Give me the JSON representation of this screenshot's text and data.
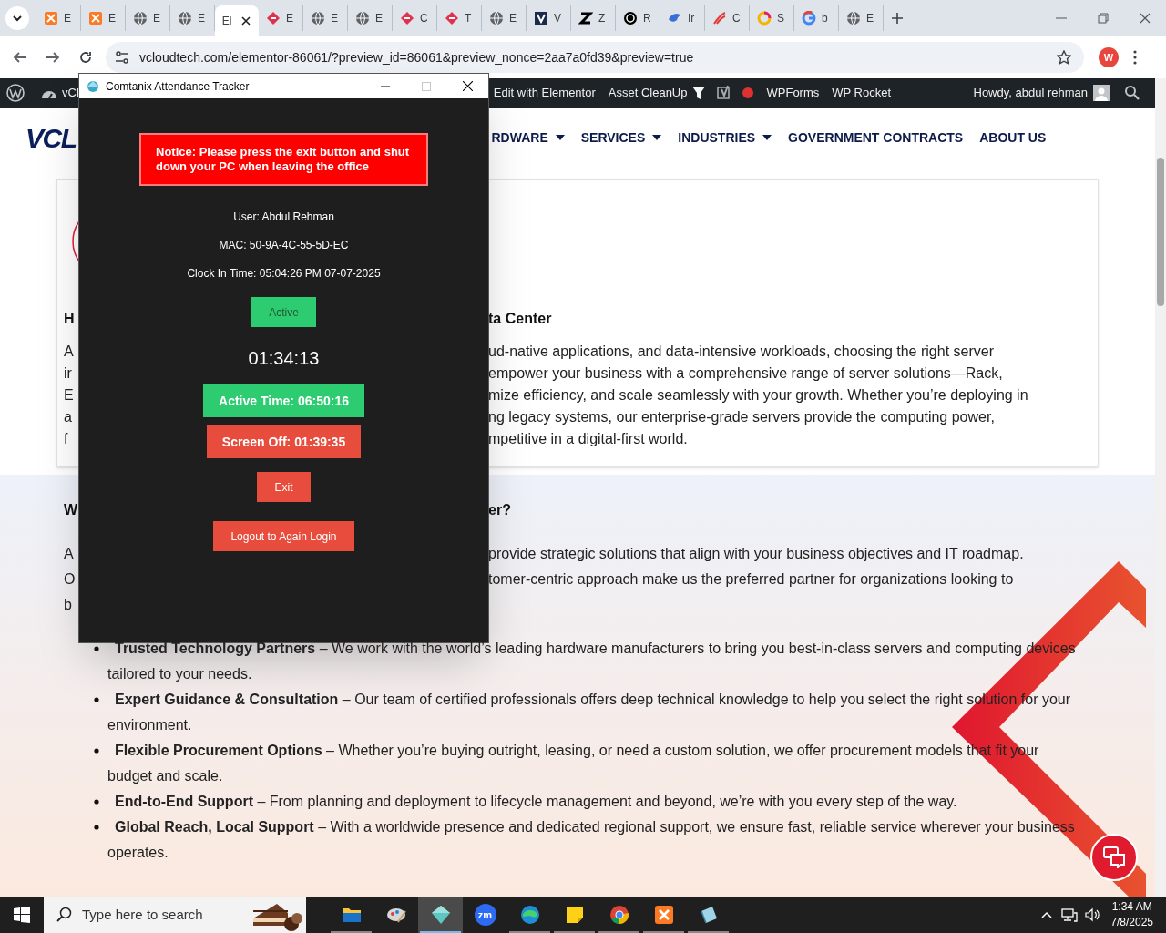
{
  "browser": {
    "tabs": [
      {
        "label": "E",
        "kind": "xampp",
        "selected": false
      },
      {
        "label": "E",
        "kind": "xampp",
        "selected": false
      },
      {
        "label": "E",
        "kind": "globe",
        "selected": false
      },
      {
        "label": "E",
        "kind": "globe",
        "selected": false
      },
      {
        "label": "El",
        "kind": "none",
        "selected": true
      },
      {
        "label": "E",
        "kind": "elementor",
        "selected": false
      },
      {
        "label": "E",
        "kind": "globe",
        "selected": false
      },
      {
        "label": "E",
        "kind": "globe",
        "selected": false
      },
      {
        "label": "C",
        "kind": "elementor",
        "selected": false
      },
      {
        "label": "T",
        "kind": "elementor",
        "selected": false
      },
      {
        "label": "E",
        "kind": "globe",
        "selected": false
      },
      {
        "label": "V",
        "kind": "vlogo",
        "selected": false
      },
      {
        "label": "Z",
        "kind": "zlogo",
        "selected": false
      },
      {
        "label": "R",
        "kind": "knot",
        "selected": false
      },
      {
        "label": "Ir",
        "kind": "bird",
        "selected": false
      },
      {
        "label": "C",
        "kind": "swoosh",
        "selected": false
      },
      {
        "label": "S",
        "kind": "ring",
        "selected": false
      },
      {
        "label": "b",
        "kind": "google",
        "selected": false
      },
      {
        "label": "E",
        "kind": "globe",
        "selected": false
      }
    ],
    "address": "vcloudtech.com/elementor-86061/?preview_id=86061&preview_nonce=2aa7a0fd39&preview=true",
    "profile": "W"
  },
  "admin_bar": {
    "site": "vCl",
    "items": [
      {
        "label": "Edit with Elementor",
        "kind": "text"
      },
      {
        "label": "Asset CleanUp",
        "kind": "funnel"
      },
      {
        "label": "WPForms",
        "kind": "text"
      },
      {
        "label": "WP Rocket",
        "kind": "text"
      }
    ],
    "greeting": "Howdy, abdul rehman"
  },
  "nav": {
    "logo": "VCL",
    "items": [
      {
        "label": "RDWARE",
        "dropdown": true
      },
      {
        "label": "SERVICES",
        "dropdown": true
      },
      {
        "label": "INDUSTRIES",
        "dropdown": true
      },
      {
        "label": "GOVERNMENT CONTRACTS",
        "dropdown": false
      },
      {
        "label": "ABOUT US",
        "dropdown": false
      }
    ]
  },
  "card": {
    "heading": {
      "left": "H",
      "right": "ta Center"
    },
    "lines": [
      {
        "left": "A",
        "right": "ud-native applications, and data-intensive workloads, choosing the right server"
      },
      {
        "left": "ir",
        "right": "empower your business with a comprehensive range of server solutions—Rack,"
      },
      {
        "left": "E",
        "right": "mize efficiency, and scale seamlessly with your growth. Whether you’re deploying in"
      },
      {
        "left": "a",
        "right": "ng legacy systems, our enterprise-grade servers provide the computing power,"
      },
      {
        "left": "f",
        "right": "mpetitive in a digital-first world."
      }
    ]
  },
  "section": {
    "heading": {
      "left": "W",
      "right": "er?"
    },
    "lines": [
      {
        "left": "A",
        "right": "provide strategic solutions that align with your business objectives and IT roadmap."
      },
      {
        "left": "O",
        "right": "tomer-centric approach make us the preferred partner for organizations looking to"
      },
      {
        "left": "b"
      }
    ],
    "bullets": [
      "**Trusted Technology Partners** – We work with the world’s leading hardware manufacturers to bring you best-in-class servers and computing devices tailored to your needs.",
      "**Expert Guidance & Consultation** – Our team of certified professionals offers deep technical knowledge to help you select the right solution for your environment.",
      "**Flexible Procurement Options** – Whether you’re buying outright, leasing, or need a custom solution, we offer procurement models that fit your budget and scale.",
      "**End-to-End Support** – From planning and deployment to lifecycle management and beyond, we’re with you every step of the way.",
      "**Global Reach, Local Support** – With a worldwide presence and dedicated regional support, we ensure fast, reliable service wherever your business operates."
    ]
  },
  "dialog": {
    "title": "Comtanix Attendance Tracker",
    "notice": "Notice: Please press the exit button and shut down your PC when leaving the office",
    "info": [
      "User: Abdul Rehman",
      "MAC: 50-9A-4C-55-5D-EC",
      "Clock In Time: 05:04:26 PM 07-07-2025"
    ],
    "status": {
      "label": "Active",
      "color": "#2ecc71"
    },
    "timer": "01:34:13",
    "buttons": [
      {
        "label": "Active Time: 06:50:16",
        "color": "#2ecc71",
        "kind": "stat"
      },
      {
        "label": "Screen Off: 01:39:35",
        "color": "#e74c3c",
        "kind": "stat"
      },
      {
        "label": "Exit",
        "color": "#e74c3c",
        "kind": "action"
      },
      {
        "label": "Logout to Again Login",
        "color": "#e74c3c",
        "kind": "action"
      }
    ]
  },
  "taskbar": {
    "search_placeholder": "Type here to search",
    "apps": [
      {
        "kind": "folder",
        "selected": false,
        "running": true
      },
      {
        "kind": "paint",
        "selected": false,
        "running": false
      },
      {
        "kind": "tracker",
        "selected": true,
        "running": true
      },
      {
        "kind": "zoom",
        "label": "zm",
        "selected": false,
        "running": false
      },
      {
        "kind": "edge",
        "selected": false,
        "running": true
      },
      {
        "kind": "notes",
        "selected": false,
        "running": true
      },
      {
        "kind": "chrome",
        "selected": false,
        "running": true
      },
      {
        "kind": "xampp",
        "selected": false,
        "running": true
      },
      {
        "kind": "sheet",
        "selected": false,
        "running": true
      }
    ],
    "time": "1:34 AM",
    "date": "7/8/2025"
  }
}
